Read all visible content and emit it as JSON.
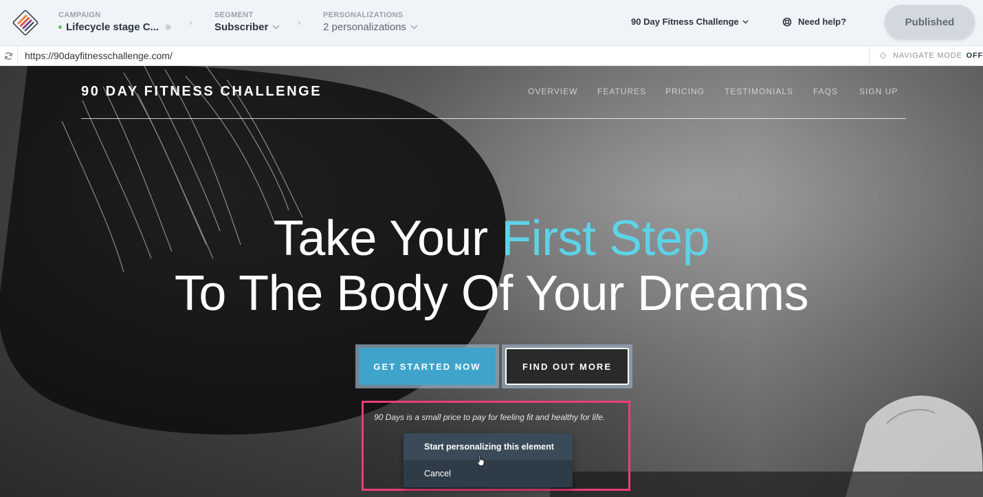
{
  "toolbar": {
    "campaign": {
      "caption": "CAMPAIGN",
      "value": "Lifecycle stage C..."
    },
    "segment": {
      "caption": "SEGMENT",
      "value": "Subscriber"
    },
    "personalizations": {
      "caption": "PERSONALIZATIONS",
      "value": "2 personalizations"
    },
    "site_select": "90 Day Fitness Challenge",
    "help": "Need help?",
    "published": "Published",
    "colors": {
      "status_dot": "#5ac46a",
      "published_bg": "#d3d8de"
    }
  },
  "urlbar": {
    "url": "https://90dayfitnesschallenge.com/",
    "navigate_mode_label": "NAVIGATE MODE",
    "navigate_mode_state": "OFF"
  },
  "page": {
    "brand": "90 DAY FITNESS CHALLENGE",
    "nav": [
      "OVERVIEW",
      "FEATURES",
      "PRICING",
      "TESTIMONIALS",
      "FAQS",
      "SIGN UP"
    ],
    "headline": {
      "line1_plain": "Take Your ",
      "line1_accent": "First Step",
      "line2": "To The Body Of Your Dreams"
    },
    "buttons": {
      "primary": "GET STARTED NOW",
      "secondary": "FIND OUT MORE"
    },
    "tagline": "90 Days is a small price to pay for feeling fit and healthy for life.",
    "colors": {
      "accent": "#5dd3e8",
      "primary_button": "#3ea4cb",
      "highlight_border": "#ea3d7b"
    }
  },
  "context_menu": {
    "items": [
      "Start personalizing this element",
      "Cancel"
    ]
  }
}
